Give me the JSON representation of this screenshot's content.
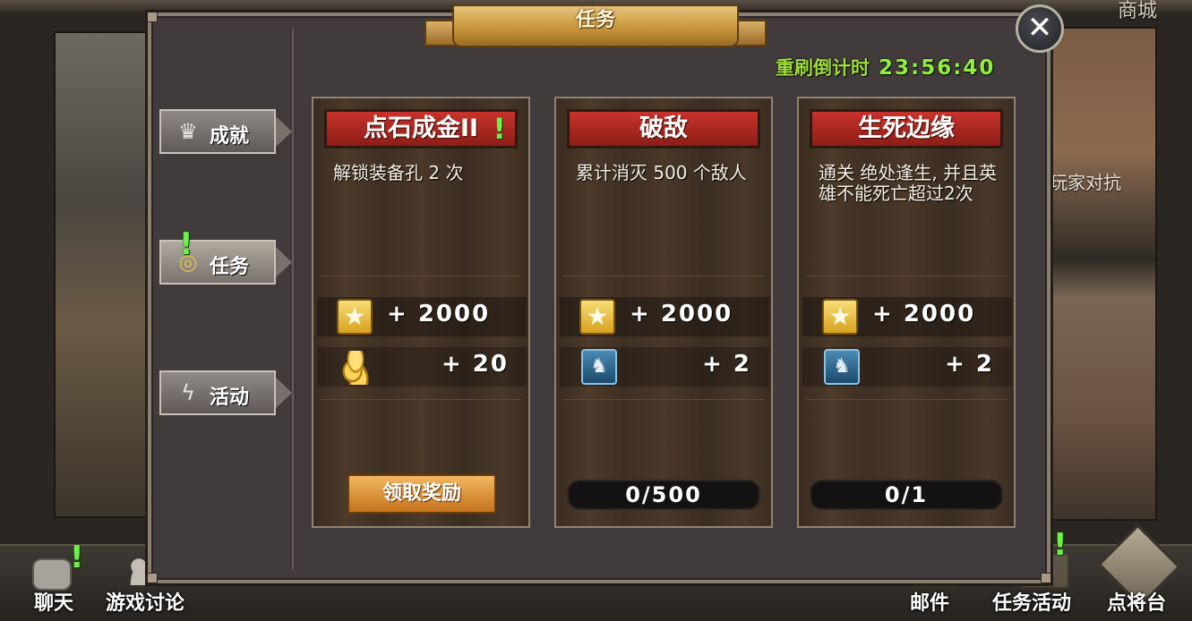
{
  "top_nav": {
    "right_item": "商城"
  },
  "background": {
    "right_caption": "玩家对抗"
  },
  "dialog": {
    "title": "任务",
    "close_glyph": "✕",
    "countdown": {
      "label": "重刷倒计时",
      "time": "23:56:40"
    }
  },
  "tabs": [
    {
      "label": "成就",
      "icon": "crown-icon",
      "active": false
    },
    {
      "label": "任务",
      "icon": "quest-icon",
      "active": true,
      "alert": "!"
    },
    {
      "label": "活动",
      "icon": "lightning-icon",
      "active": false
    }
  ],
  "quests": [
    {
      "title": "点石成金II",
      "alert": "!",
      "description": "解锁装备孔 2 次",
      "rewards": [
        {
          "icon": "star-icon",
          "value": "+ 2000"
        },
        {
          "icon": "gold-coins-icon",
          "value": "+ 20"
        }
      ],
      "action": {
        "type": "button",
        "label": "领取奖励"
      }
    },
    {
      "title": "破敌",
      "description": "累计消灭 500 个敌人",
      "rewards": [
        {
          "icon": "star-icon",
          "value": "+ 2000"
        },
        {
          "icon": "hero-card-icon",
          "value": "+ 2"
        }
      ],
      "action": {
        "type": "progress",
        "label": "0/500",
        "fraction": 0
      }
    },
    {
      "title": "生死边缘",
      "description": "通关 绝处逢生, 并且英雄不能死亡超过2次",
      "rewards": [
        {
          "icon": "star-icon",
          "value": "+ 2000"
        },
        {
          "icon": "hero-card-icon",
          "value": "+ 2"
        }
      ],
      "action": {
        "type": "progress",
        "label": "0/1",
        "fraction": 0
      }
    }
  ],
  "bottom_bar": {
    "chat": "聊天",
    "forum": "游戏讨论",
    "mail": "邮件",
    "task_activity": "任务活动",
    "general_stage": "点将台",
    "alert": "!"
  },
  "colors": {
    "accent_green": "#8ff03a",
    "title_red": "#c8332b",
    "claim_orange": "#e09a3c",
    "ribbon_gold": "#c8963c"
  }
}
